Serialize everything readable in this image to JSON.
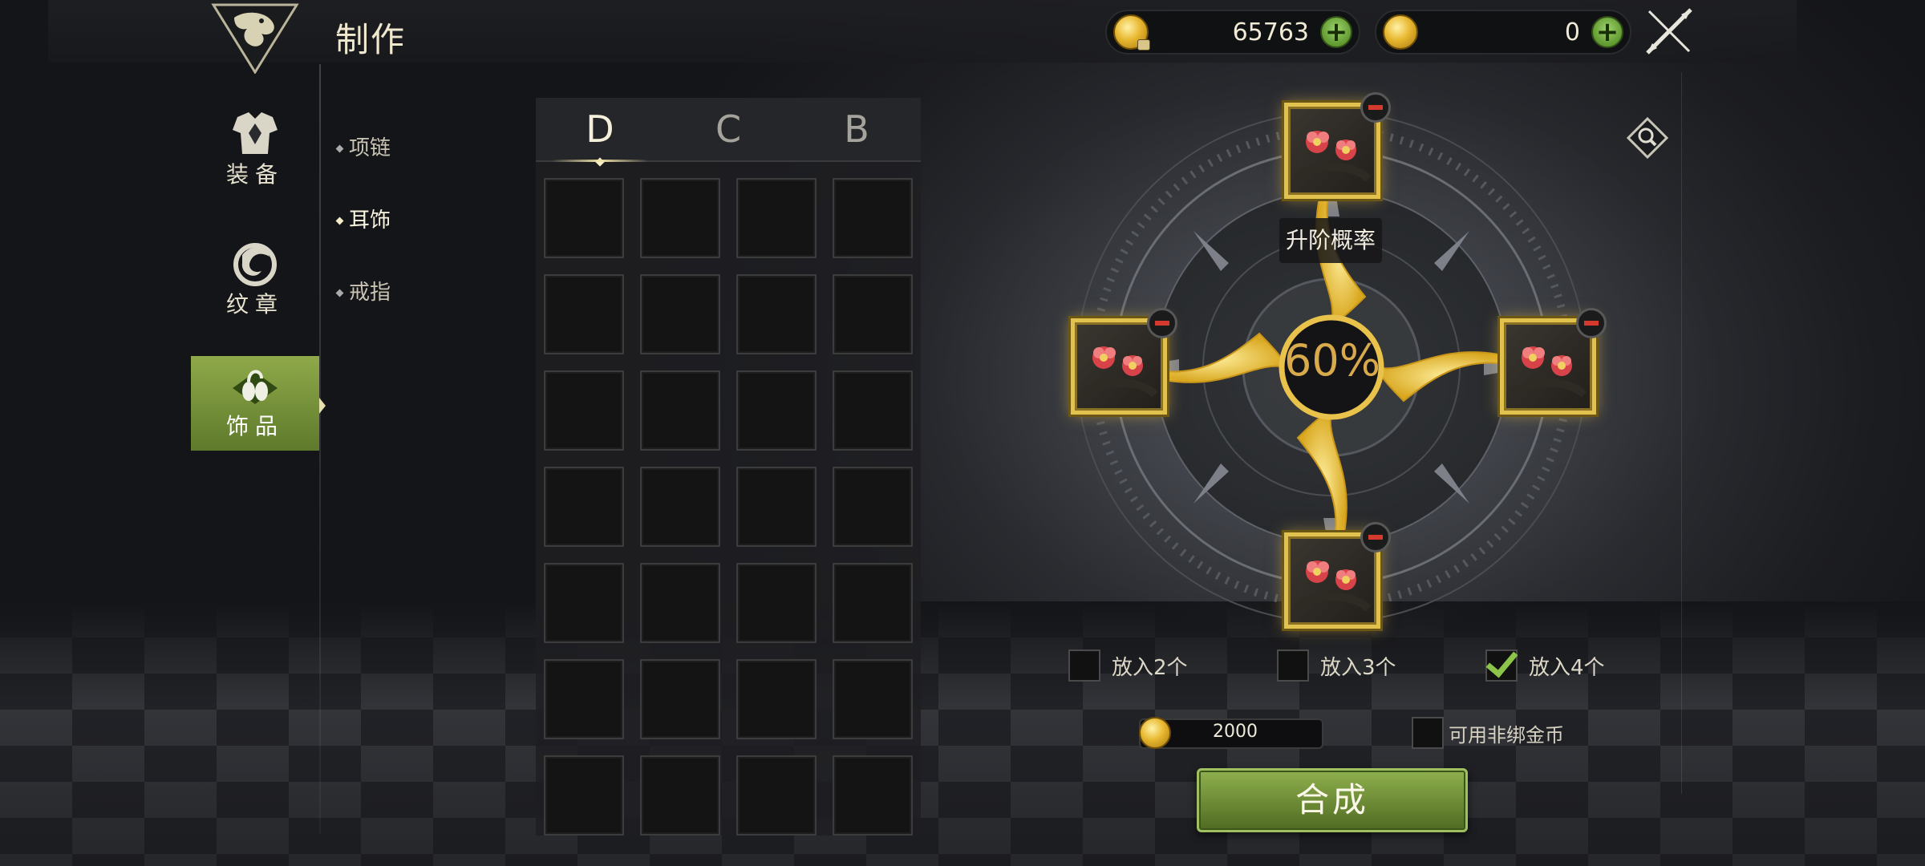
{
  "header": {
    "title": "制作",
    "currency_bound": {
      "amount": "65763",
      "icon": "bound-gold-coin-icon"
    },
    "currency_free": {
      "amount": "0",
      "icon": "gold-coin-icon"
    }
  },
  "nav": {
    "items": [
      {
        "label": "装备",
        "icon": "armor-icon"
      },
      {
        "label": "纹章",
        "icon": "emblem-icon"
      },
      {
        "label": "饰品",
        "icon": "accessory-icon",
        "active": true
      }
    ]
  },
  "subnav": {
    "items": [
      {
        "label": "项链"
      },
      {
        "label": "耳饰",
        "active": true
      },
      {
        "label": "戒指"
      }
    ]
  },
  "grade_tabs": [
    {
      "label": "D",
      "active": true
    },
    {
      "label": "C"
    },
    {
      "label": "B"
    }
  ],
  "craft": {
    "rate_label": "升阶概率",
    "rate_value": "60%",
    "slot_item_icon": "red-flower-earring-icon",
    "options": [
      {
        "label": "放入2个",
        "checked": false
      },
      {
        "label": "放入3个",
        "checked": false
      },
      {
        "label": "放入4个",
        "checked": true
      }
    ],
    "cost": "2000",
    "nonbind_label": "可用非绑金币",
    "nonbind_checked": false,
    "button_label": "合成"
  },
  "colors": {
    "accent_green": "#6c8a35",
    "gold": "#e2c24e",
    "rate_text": "#d8aa4c"
  }
}
